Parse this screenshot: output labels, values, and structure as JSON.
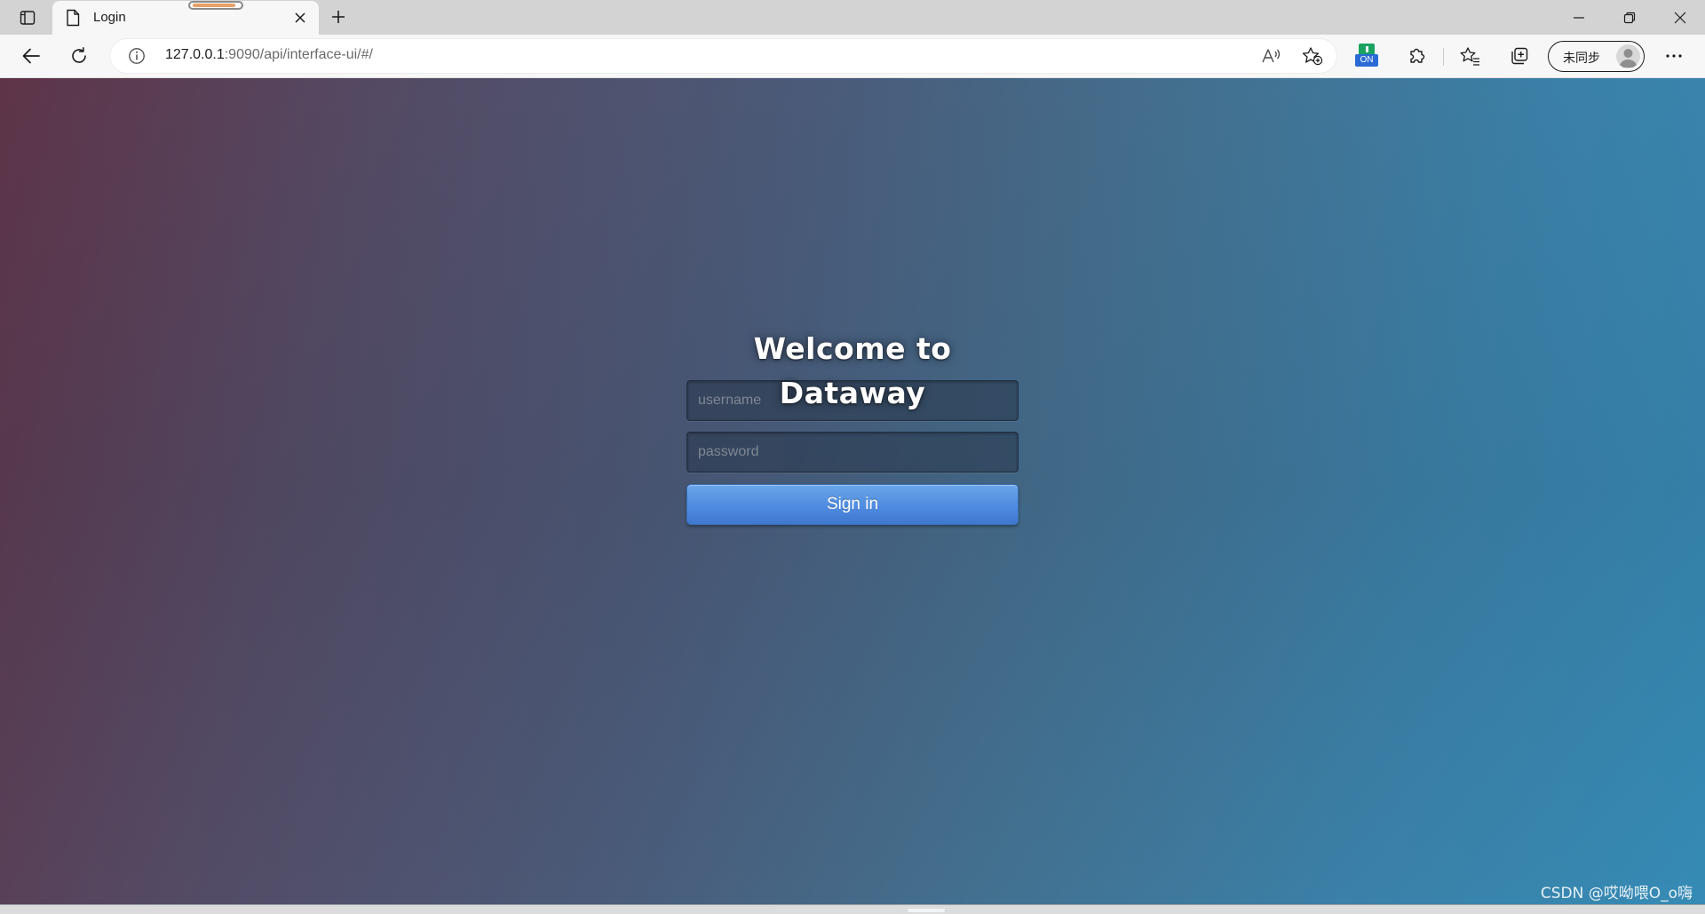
{
  "browser": {
    "tab": {
      "title": "Login",
      "icon": "page-icon"
    },
    "address": {
      "url_host": "127.0.0.1",
      "url_rest": ":9090/api/interface-ui/#/"
    },
    "extension_badge": "ON",
    "sync_label": "未同步",
    "icons": {
      "tab_actions": "tab-actions-icon",
      "close": "close-icon",
      "new_tab": "plus-icon",
      "back": "back-arrow-icon",
      "refresh": "refresh-icon",
      "info": "info-icon",
      "read_aloud": "read-aloud-icon",
      "add_favorite": "add-favorite-icon",
      "extensions": "puzzle-icon",
      "favorites": "favorites-icon",
      "collections": "collections-icon",
      "more": "ellipsis-icon",
      "minimize": "minimize-icon",
      "restore": "restore-icon",
      "window_close": "window-close-icon"
    }
  },
  "login": {
    "title": "Welcome to Dataway",
    "username_placeholder": "username",
    "password_placeholder": "password",
    "signin_label": "Sign in"
  },
  "watermark": "CSDN @哎呦喂O_o嗨",
  "colors": {
    "gradient_left": "#5e3448",
    "gradient_right": "#358bb5",
    "button_blue": "#4f8be0",
    "extension_green": "#1aa260",
    "extension_blue": "#2b6bd6"
  }
}
